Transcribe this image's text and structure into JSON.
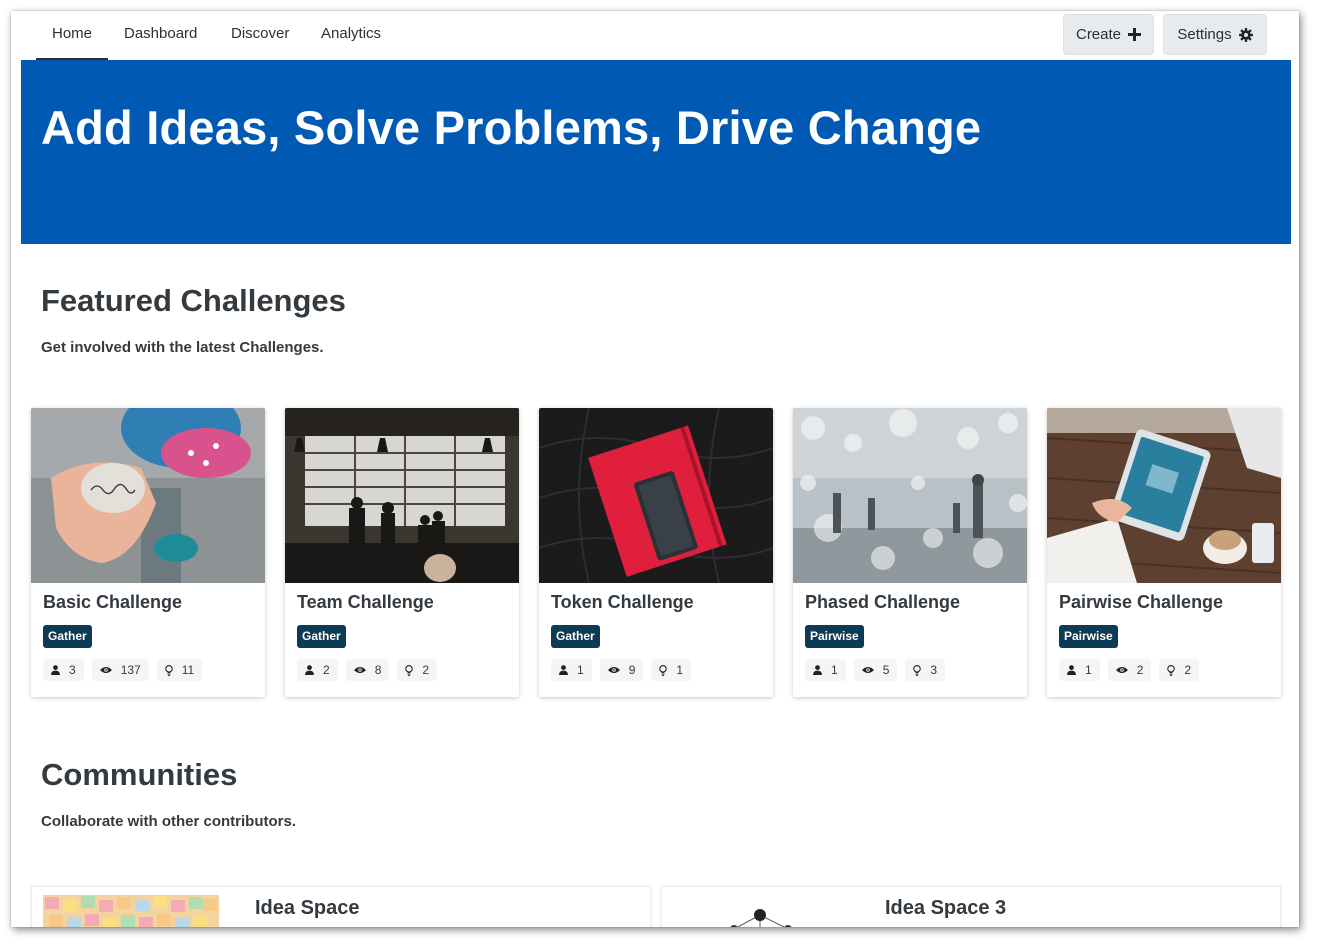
{
  "nav": {
    "tabs": [
      {
        "label": "Home",
        "active": true
      },
      {
        "label": "Dashboard",
        "active": false
      },
      {
        "label": "Discover",
        "active": false
      },
      {
        "label": "Analytics",
        "active": false
      }
    ],
    "create_label": "Create",
    "create_icon": "plus-icon",
    "settings_label": "Settings",
    "settings_icon": "gear-icon"
  },
  "hero": {
    "title": "Add Ideas, Solve Problems, Drive Change",
    "background": "#0059b3"
  },
  "featured": {
    "title": "Featured Challenges",
    "subtitle": "Get involved with the latest Challenges.",
    "cards": [
      {
        "title": "Basic Challenge",
        "badge": "Gather",
        "participants": "3",
        "views": "137",
        "ideas": "11",
        "image": "hand-holding-stone-photo"
      },
      {
        "title": "Team Challenge",
        "badge": "Gather",
        "participants": "2",
        "views": "8",
        "ideas": "2",
        "image": "workshop-people-photo"
      },
      {
        "title": "Token Challenge",
        "badge": "Gather",
        "participants": "1",
        "views": "9",
        "ideas": "1",
        "image": "red-notebook-phone-photo"
      },
      {
        "title": "Phased Challenge",
        "badge": "Pairwise",
        "participants": "1",
        "views": "5",
        "ideas": "3",
        "image": "bokeh-mall-photo"
      },
      {
        "title": "Pairwise Challenge",
        "badge": "Pairwise",
        "participants": "1",
        "views": "2",
        "ideas": "2",
        "image": "tablet-coffee-photo"
      }
    ]
  },
  "communities": {
    "title": "Communities",
    "subtitle": "Collaborate with other contributors.",
    "items": [
      {
        "title": "Idea Space",
        "image": "sticky-notes-photo"
      },
      {
        "title": "Idea Space 3",
        "image": "network-graph-icon"
      }
    ]
  },
  "colors": {
    "badge": "#0d3a55",
    "button_bg": "#e8ebee",
    "text": "#333a40"
  }
}
